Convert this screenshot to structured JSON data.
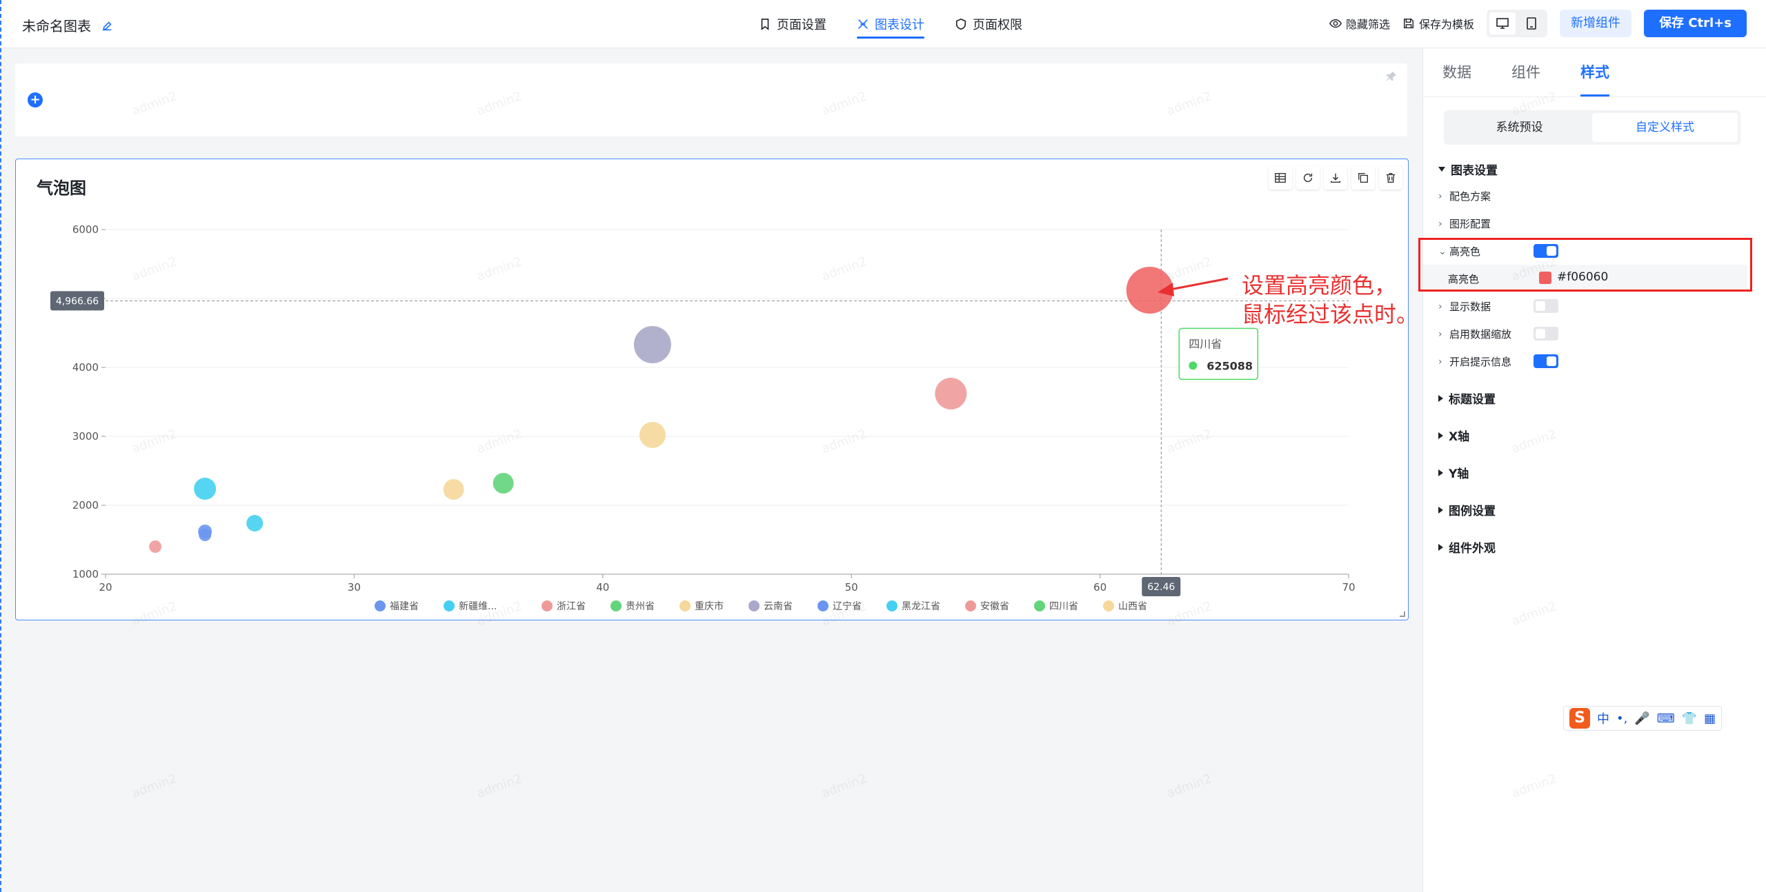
{
  "header": {
    "title": "未命名图表",
    "tabs": [
      {
        "label": "页面设置",
        "icon": "bookmark-icon"
      },
      {
        "label": "图表设计",
        "icon": "design-icon",
        "active": true
      },
      {
        "label": "页面权限",
        "icon": "shield-icon"
      }
    ],
    "hide_filter": "隐藏筛选",
    "save_template": "保存为模板",
    "add_component": "新增组件",
    "save": "保存 Ctrl+s",
    "accent_color": "#1f6fff"
  },
  "watermark": "admin2",
  "chart": {
    "title": "气泡图",
    "crosshair_y_label": "4,966.66",
    "crosshair_x_label": "62.46",
    "tooltip": {
      "name": "四川省",
      "value": "625088",
      "color": "#4cd964"
    }
  },
  "chart_data": {
    "type": "scatter",
    "title": "气泡图",
    "xlabel": "",
    "ylabel": "",
    "xlim": [
      20,
      70
    ],
    "ylim": [
      1000,
      6000
    ],
    "x_ticks": [
      "20",
      "30",
      "40",
      "50",
      "60",
      "70"
    ],
    "y_ticks": [
      "1000",
      "2000",
      "3000",
      "4000",
      "5000",
      "6000"
    ],
    "grid": true,
    "legend_position": "bottom",
    "series": [
      {
        "name": "福建省",
        "color": "#6b96f0",
        "points": [
          {
            "x": 24,
            "y": 1620,
            "size": 10
          }
        ]
      },
      {
        "name": "新疆维...",
        "color": "#44d0f2",
        "points": [
          {
            "x": 24,
            "y": 2240,
            "size": 16
          }
        ]
      },
      {
        "name": "浙江省",
        "color": "#ef9a9a",
        "points": [
          {
            "x": 22,
            "y": 1400,
            "size": 9
          }
        ]
      },
      {
        "name": "贵州省",
        "color": "#62d47a",
        "points": [
          {
            "x": 36,
            "y": 2320,
            "size": 15
          }
        ]
      },
      {
        "name": "重庆市",
        "color": "#f5d89a",
        "points": [
          {
            "x": 34,
            "y": 2230,
            "size": 15
          }
        ]
      },
      {
        "name": "云南省",
        "color": "#a9a8c8",
        "points": [
          {
            "x": 42,
            "y": 4330,
            "size": 27
          }
        ]
      },
      {
        "name": "辽宁省",
        "color": "#6b96f0",
        "points": [
          {
            "x": 24,
            "y": 1570,
            "size": 9
          }
        ]
      },
      {
        "name": "黑龙江省",
        "color": "#44d0f2",
        "points": [
          {
            "x": 26,
            "y": 1740,
            "size": 12
          }
        ]
      },
      {
        "name": "安徽省",
        "color": "#ef9a9a",
        "points": [
          {
            "x": 54,
            "y": 3620,
            "size": 23
          }
        ]
      },
      {
        "name": "四川省",
        "color": "#62d47a",
        "highlight_color": "#f06060",
        "points": [
          {
            "x": 62,
            "y": 5120,
            "size": 34
          }
        ]
      },
      {
        "name": "山西省",
        "color": "#f5d89a",
        "points": [
          {
            "x": 42,
            "y": 3020,
            "size": 19
          }
        ]
      }
    ]
  },
  "panel": {
    "tabs": [
      "数据",
      "组件",
      "样式"
    ],
    "active_tab": 2,
    "seg": [
      "系统预设",
      "自定义样式"
    ],
    "sections": {
      "chart_settings": "图表设置",
      "color_scheme": "配色方案",
      "shape_config": "图形配置",
      "highlight": "高亮色",
      "highlight_color_label": "高亮色",
      "highlight_color_value": "#f06060",
      "show_data": "显示数据",
      "data_zoom": "启用数据缩放",
      "tooltip": "开启提示信息",
      "title_settings": "标题设置",
      "x_axis": "X轴",
      "y_axis": "Y轴",
      "legend_settings": "图例设置",
      "appearance": "组件外观"
    }
  },
  "annotation": {
    "line1": "设置高亮颜色，",
    "line2": "鼠标经过该点时。",
    "color": "#e83030"
  },
  "ime": {
    "logo": "S",
    "items": [
      "中",
      "•,",
      "🎤",
      "⌨",
      "👕",
      "▦"
    ]
  }
}
